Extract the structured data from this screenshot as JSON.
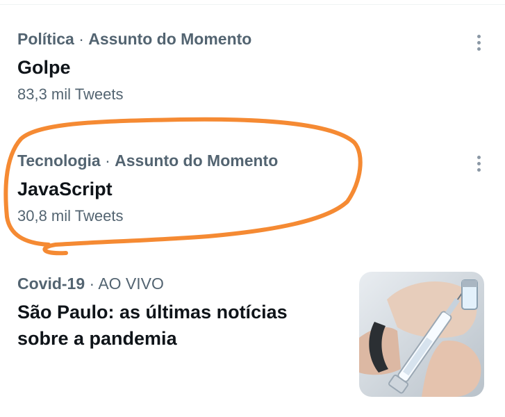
{
  "trends": [
    {
      "category": "Política",
      "separator": " · ",
      "context": "Assunto do Momento",
      "title": "Golpe",
      "count": "83,3 mil Tweets"
    },
    {
      "category": "Tecnologia",
      "separator": " · ",
      "context": "Assunto do Momento",
      "title": "JavaScript",
      "count": "30,8 mil Tweets"
    }
  ],
  "news": {
    "category": "Covid-19",
    "separator": " · ",
    "context": "AO VIVO",
    "title": "São Paulo: as últimas notícias sobre a pandemia",
    "image_icon": "syringe-vaccine-image"
  },
  "colors": {
    "secondary_text": "#536471",
    "primary_text": "#0f1419",
    "highlight_stroke": "#f58a33",
    "more_dots": "#8b98a5"
  }
}
